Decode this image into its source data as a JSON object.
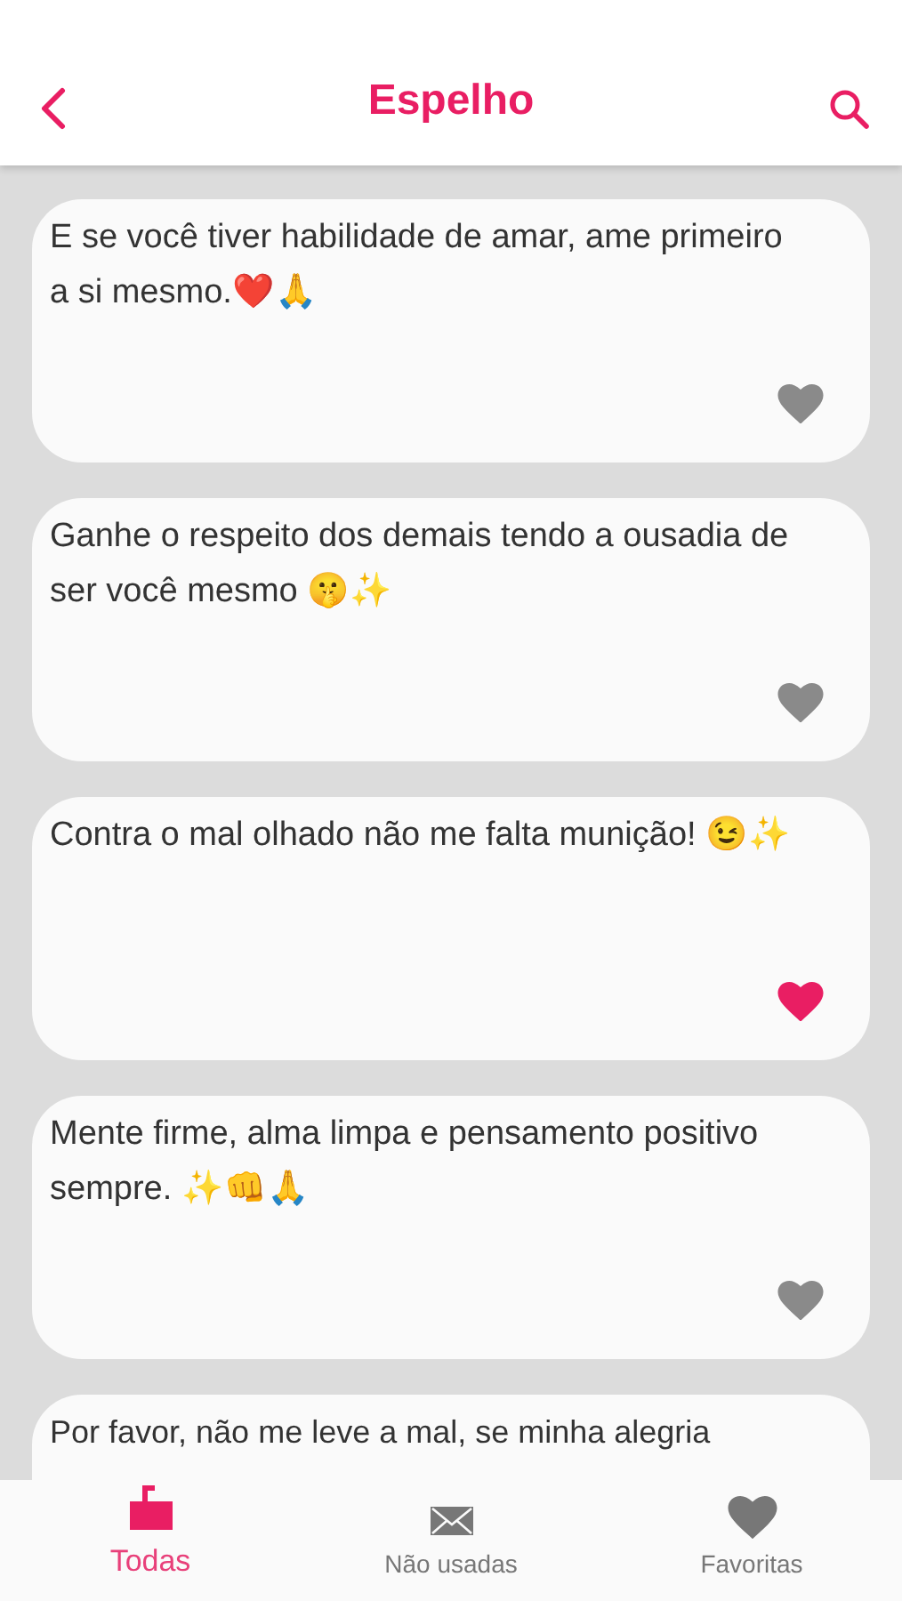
{
  "header": {
    "title": "Espelho"
  },
  "quotes": [
    {
      "text": "E se você tiver habilidade de amar, ame primeiro a si mesmo.❤️🙏",
      "favorite": false
    },
    {
      "text": "Ganhe o respeito dos demais tendo a ousadia de ser você mesmo 🤫✨",
      "favorite": false
    },
    {
      "text": "Contra o mal olhado não me falta munição! 😉✨",
      "favorite": true
    },
    {
      "text": "Mente firme, alma limpa e pensamento positivo sempre. ✨👊🙏",
      "favorite": false
    }
  ],
  "cut_quote": {
    "text": "Por favor, não me leve a mal, se minha alegria"
  },
  "tabs": [
    {
      "label": "Todas",
      "kind": "all",
      "selected": true
    },
    {
      "label": "Não usadas",
      "kind": "unused",
      "selected": false
    },
    {
      "label": "Favoritas",
      "kind": "favorites",
      "selected": false
    }
  ]
}
